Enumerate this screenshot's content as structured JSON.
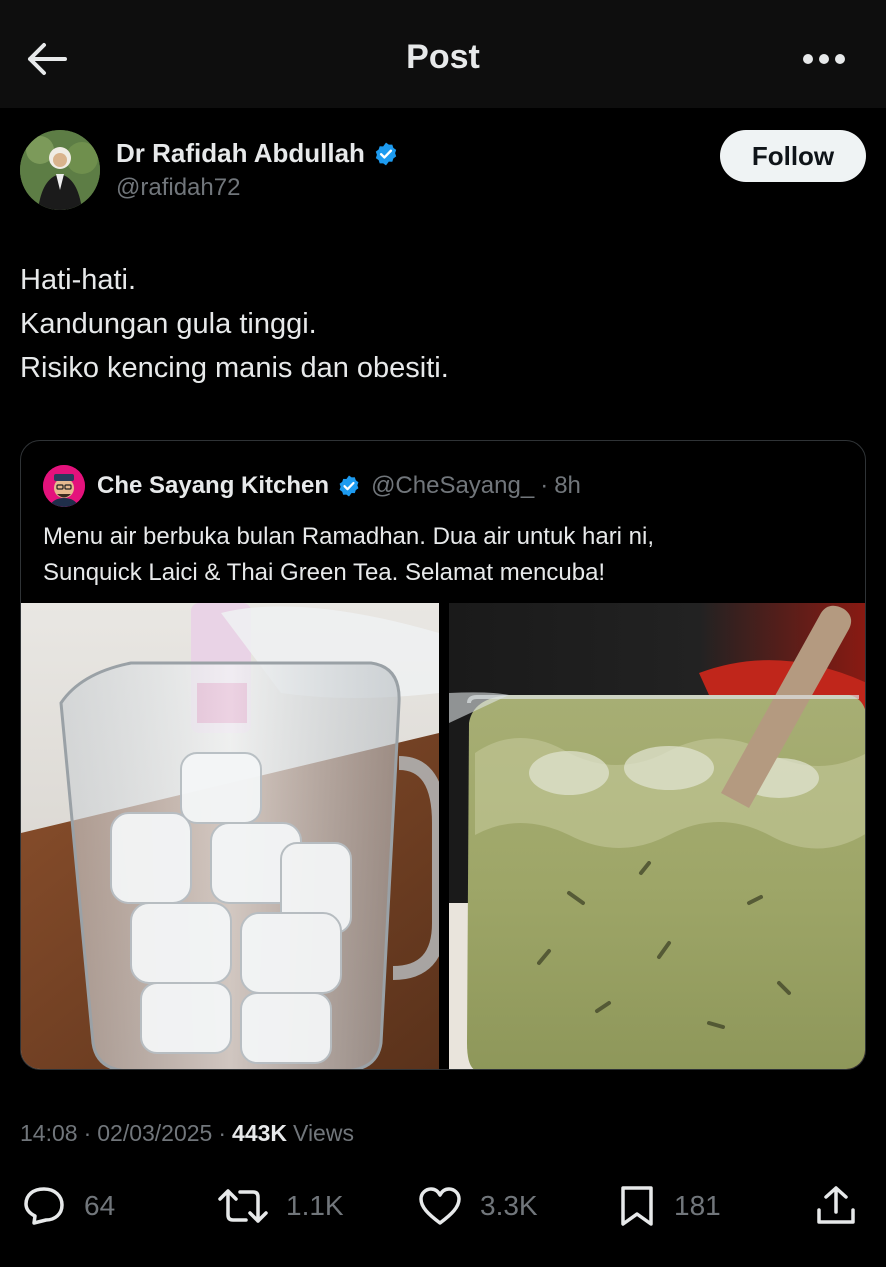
{
  "header": {
    "title": "Post"
  },
  "author": {
    "name": "Dr Rafidah Abdullah",
    "handle": "@rafidah72",
    "follow_label": "Follow"
  },
  "post": {
    "lines": [
      "Hati-hati.",
      "Kandungan gula tinggi.",
      "Risiko kencing manis dan obesiti."
    ]
  },
  "quote": {
    "name": "Che Sayang Kitchen",
    "handle": "@CheSayang_",
    "dot": "·",
    "time": "8h",
    "lines": [
      "Menu air berbuka bulan Ramadhan. Dua air untuk hari ni,",
      "Sunquick Laici & Thai Green Tea. Selamat mencuba!"
    ]
  },
  "meta": {
    "time": "14:08",
    "date": "02/03/2025",
    "views": "443K",
    "views_label": "Views",
    "sep": "·"
  },
  "actions": {
    "replies": "64",
    "reposts": "1.1K",
    "likes": "3.3K",
    "bookmarks": "181"
  },
  "colors": {
    "background": "#000000",
    "verified": "#1d9bf0",
    "muted": "#71767b",
    "text": "#e7e9ea"
  },
  "icons": [
    "back-arrow-icon",
    "more-icon",
    "verified-icon",
    "reply-icon",
    "repost-icon",
    "like-icon",
    "bookmark-icon",
    "share-icon"
  ]
}
